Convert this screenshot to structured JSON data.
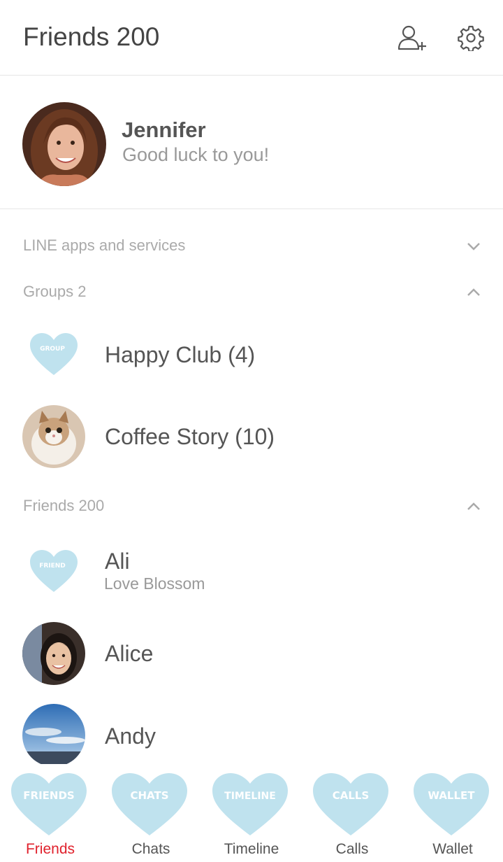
{
  "header": {
    "title": "Friends 200",
    "add_friend_icon": "add-friend-icon",
    "settings_icon": "gear-icon"
  },
  "profile": {
    "name": "Jennifer",
    "status": "Good luck to you!"
  },
  "sections": {
    "line_apps": "LINE apps and services",
    "groups": "Groups 2",
    "friends": "Friends 200"
  },
  "groups": [
    {
      "name": "Happy Club (4)",
      "badge": "GROUP"
    },
    {
      "name": "Coffee Story (10)"
    }
  ],
  "friends": [
    {
      "name": "Ali",
      "status": "Love Blossom",
      "badge": "FRIEND"
    },
    {
      "name": "Alice"
    },
    {
      "name": "Andy"
    }
  ],
  "tabs": [
    {
      "heart_text": "FRIENDS",
      "label": "Friends",
      "active": true
    },
    {
      "heart_text": "CHATS",
      "label": "Chats",
      "active": false
    },
    {
      "heart_text": "TIMELINE",
      "label": "Timeline",
      "active": false
    },
    {
      "heart_text": "CALLS",
      "label": "Calls",
      "active": false
    },
    {
      "heart_text": "WALLET",
      "label": "Wallet",
      "active": false
    }
  ],
  "colors": {
    "heart": "#bfe2ee",
    "active_tab": "#e0212c",
    "divider": "#e6e6e6"
  }
}
